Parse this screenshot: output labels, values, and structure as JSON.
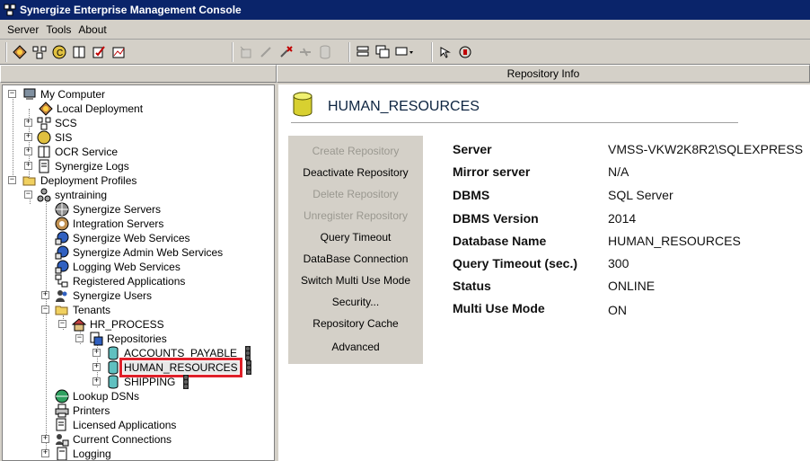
{
  "window": {
    "title": "Synergize Enterprise Management Console"
  },
  "menu": [
    "Server",
    "Tools",
    "About"
  ],
  "header": {
    "left": "",
    "right": "Repository Info"
  },
  "tree": {
    "my_computer": "My Computer",
    "local_deployment": "Local Deployment",
    "scs": "SCS",
    "sis": "SIS",
    "ocr_service": "OCR Service",
    "synergize_logs": "Synergize Logs",
    "deployment_profiles": "Deployment Profiles",
    "syntraining": "syntraining",
    "synergize_servers": "Synergize Servers",
    "integration_servers": "Integration Servers",
    "synergize_web_services": "Synergize Web Services",
    "synergize_admin_web_services": "Synergize Admin Web Services",
    "logging_web_services": "Logging Web Services",
    "registered_applications": "Registered Applications",
    "synergize_users": "Synergize Users",
    "tenants": "Tenants",
    "hr_process": "HR_PROCESS",
    "repositories": "Repositories",
    "accounts_payable": "ACCOUNTS_PAYABLE",
    "human_resources": "HUMAN_RESOURCES",
    "shipping": "SHIPPING",
    "lookup_dsns": "Lookup DSNs",
    "printers": "Printers",
    "licensed_applications": "Licensed Applications",
    "current_connections": "Current Connections",
    "logging": "Logging"
  },
  "repo": {
    "title": "HUMAN_RESOURCES"
  },
  "actions": {
    "create": "Create Repository",
    "deactivate": "Deactivate Repository",
    "delete": "Delete Repository",
    "unregister": "Unregister Repository",
    "query_timeout": "Query Timeout",
    "db_connection": "DataBase Connection",
    "switch_multi": "Switch Multi Use Mode",
    "security": "Security...",
    "cache": "Repository Cache",
    "advanced": "Advanced"
  },
  "info": {
    "server_label": "Server",
    "server_value": "VMSS-VKW2K8R2\\SQLEXPRESS",
    "mirror_label": "Mirror server",
    "mirror_value": "N/A",
    "dbms_label": "DBMS",
    "dbms_value": "SQL Server",
    "dbms_version_label": "DBMS Version",
    "dbms_version_value": "2014",
    "db_name_label": "Database Name",
    "db_name_value": "HUMAN_RESOURCES",
    "timeout_label": "Query Timeout (sec.)",
    "timeout_value": "300",
    "status_label": "Status",
    "status_value": "ONLINE",
    "multi_label": "Multi Use Mode",
    "multi_value": "ON"
  },
  "colors": {
    "titlebar": "#0a246a",
    "highlight_box": "#e0202a",
    "title_text": "#0d2440"
  }
}
